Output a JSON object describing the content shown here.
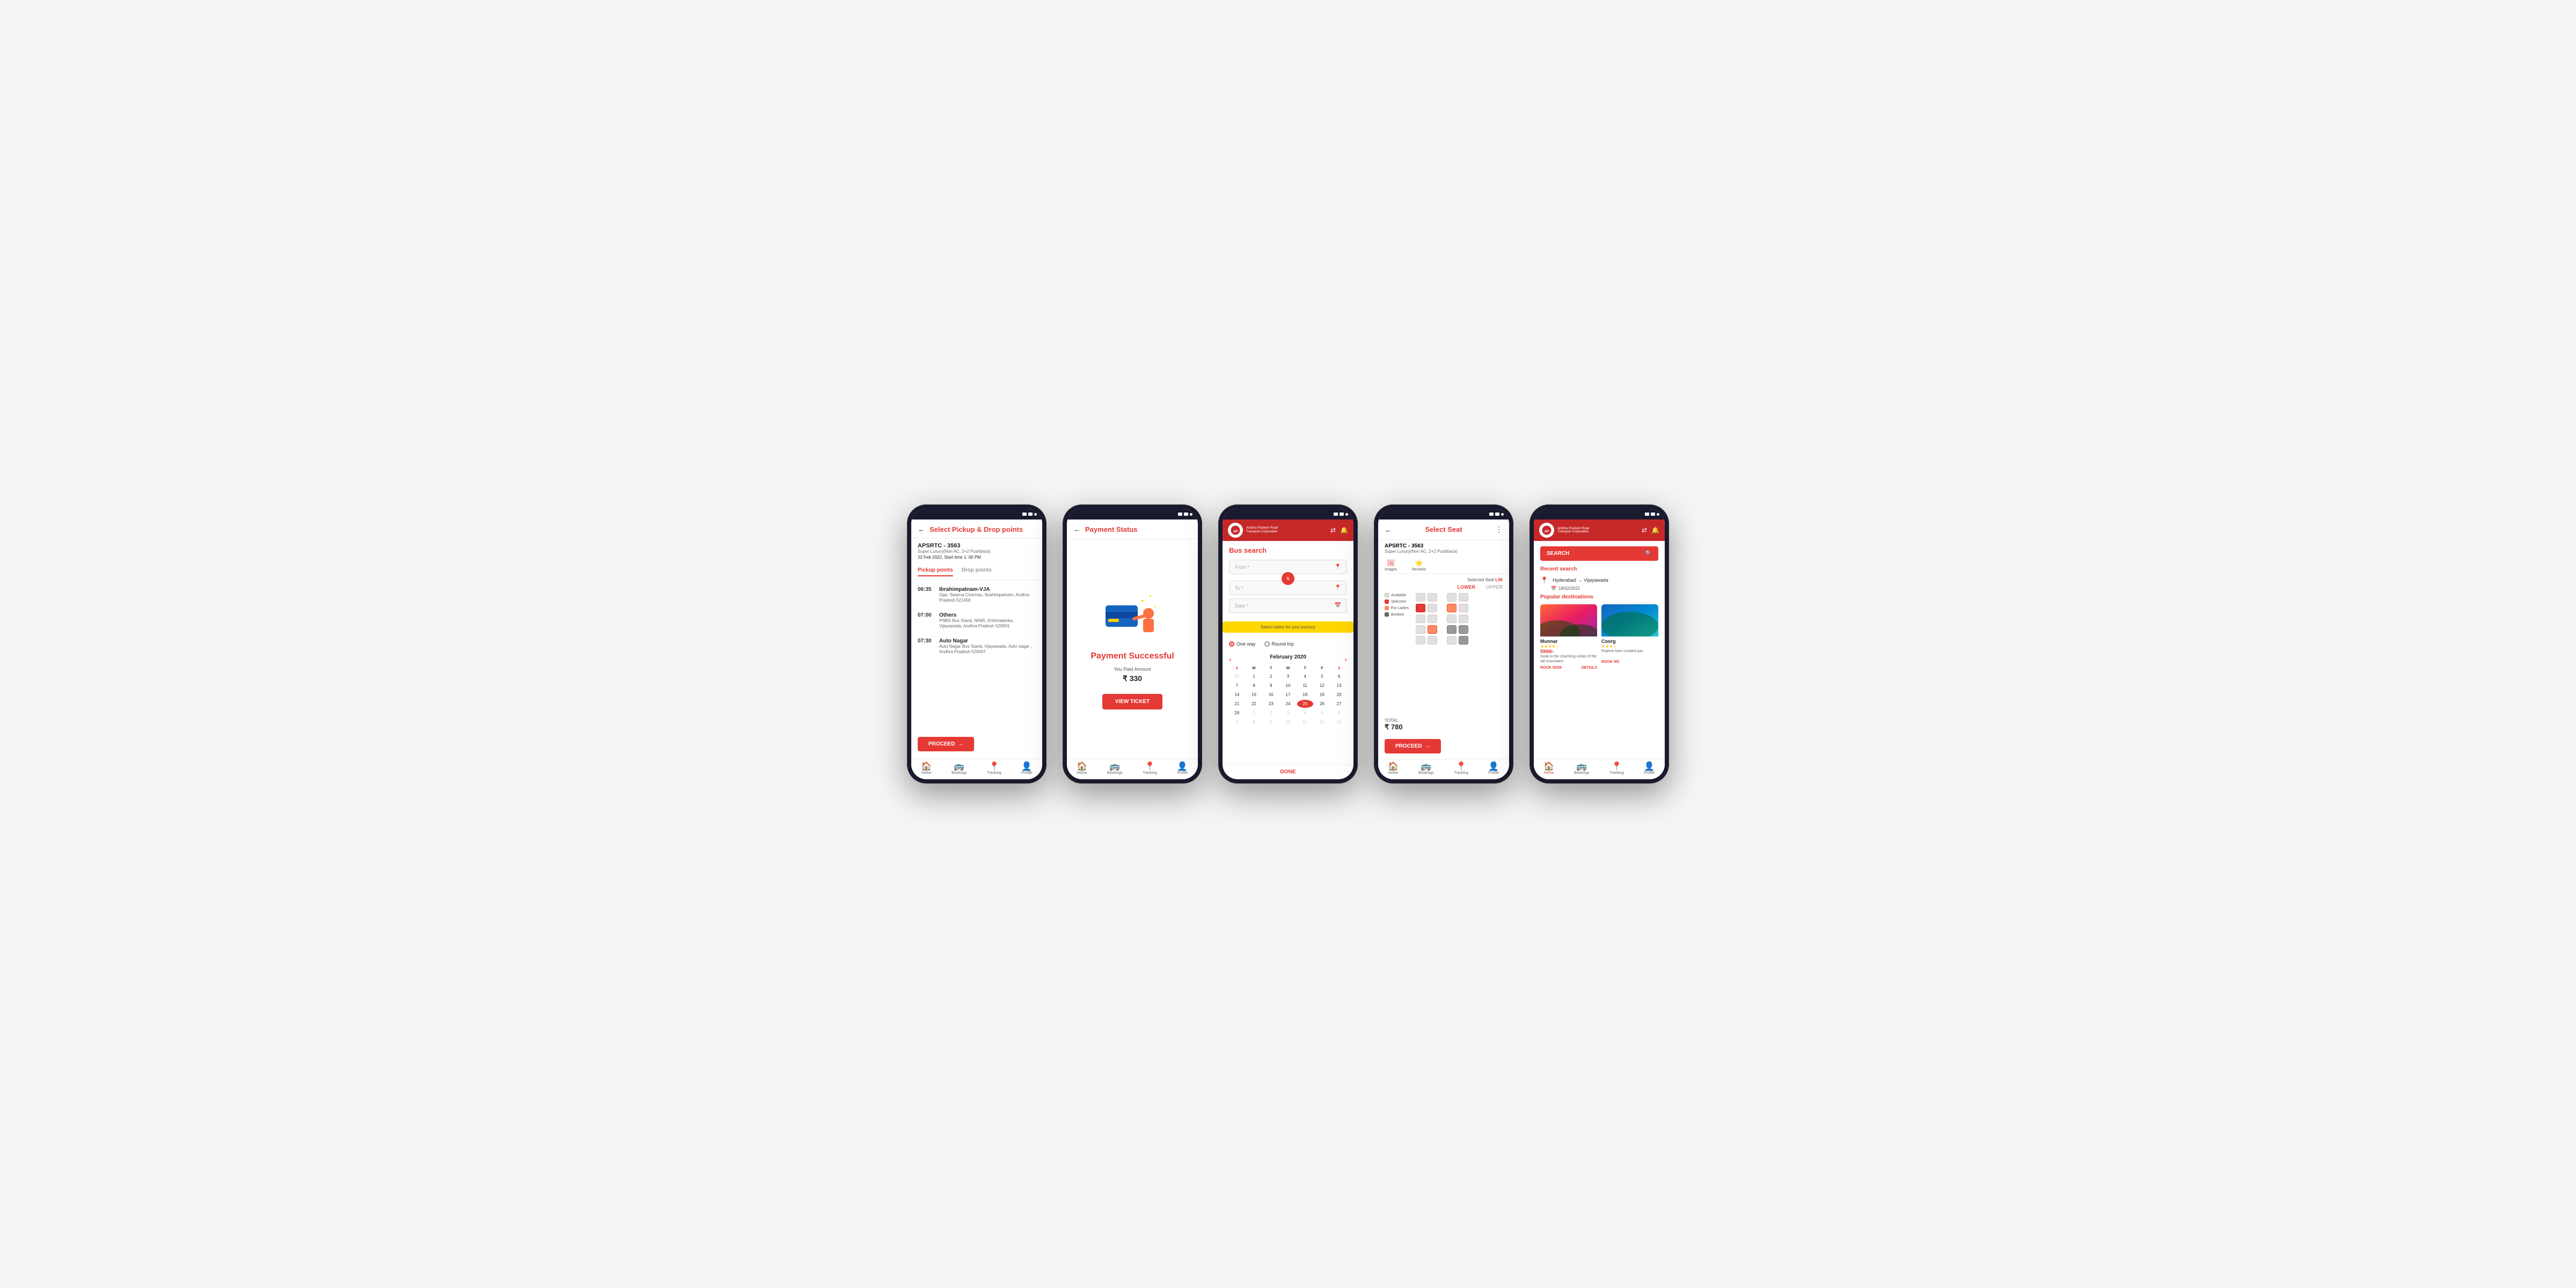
{
  "phone1": {
    "status_bar": "status",
    "header": {
      "back_label": "←",
      "title": "Select Pickup & Drop points"
    },
    "bus": {
      "name": "APSRTC - 3563",
      "type": "Super Luxury(Non AC, 2+2 Pushback)",
      "date": "22 Feb 2022, Start time 1: 00 PM"
    },
    "tabs": {
      "pickup": "Pickup points",
      "drop": "Drop points"
    },
    "stops": [
      {
        "time": "06:35",
        "name": "Ibrahimpatnam-VJA",
        "address": "Opp. Swarna Cinemax, Ibrahimpatnam, Andhra Pradesh 521456"
      },
      {
        "time": "07:00",
        "name": "Others",
        "address": "PNBS Bus Stand, NH65, Krishnalanka, Vijayawada, Andhra Pradesh 520001"
      },
      {
        "time": "07:30",
        "name": "Auto Nagar",
        "address": "Auto Nagar Bus Stand, Vijayawada, Auto nagar , Andhra Pradesh 520007"
      }
    ],
    "proceed_btn": "PROCEED",
    "nav": {
      "home": "Home",
      "bookings": "Bookings",
      "tracking": "Tracking",
      "profile": "Profile"
    }
  },
  "phone2": {
    "header": {
      "back_label": "←",
      "title": "Payment Status"
    },
    "success_title": "Payment Successful",
    "amount_label": "You Paid Amount",
    "amount": "₹ 330",
    "view_ticket_btn": "VIEW TICKET",
    "nav": {
      "home": "Home",
      "bookings": "Bookings",
      "tracking": "Tracking",
      "profile": "Profile"
    }
  },
  "phone3": {
    "logo_text": "Andhra Pradesh Road Transport Corporation",
    "search_title": "Bus search",
    "from_placeholder": "From *",
    "to_placeholder": "To *",
    "date_placeholder": "Date *",
    "date_banner": "Select dates for your journey",
    "trip_options": {
      "one_way": "One way",
      "round_trip": "Round trip"
    },
    "calendar": {
      "month_year": "February 2020",
      "day_headers": [
        "S",
        "M",
        "T",
        "W",
        "T",
        "F",
        "S"
      ],
      "weeks": [
        [
          "31",
          "1",
          "2",
          "3",
          "4",
          "5",
          "6"
        ],
        [
          "7",
          "8",
          "9",
          "10",
          "11",
          "12",
          "13"
        ],
        [
          "14",
          "15",
          "16",
          "17",
          "18",
          "19",
          "20"
        ],
        [
          "21",
          "22",
          "23",
          "24",
          "25",
          "26",
          "27"
        ],
        [
          "28",
          "1",
          "2",
          "3",
          "4",
          "5",
          "6"
        ],
        [
          "7",
          "8",
          "9",
          "10",
          "11",
          "12",
          "13"
        ]
      ],
      "today_index": "25",
      "today_week": 3,
      "today_day": 4
    },
    "done_btn": "DONE",
    "nav": {
      "home": "Home",
      "bookings": "Bookings",
      "tracking": "Tracking",
      "profile": "Profile"
    }
  },
  "phone4": {
    "header": {
      "back_label": "←",
      "title": "Select Seat",
      "more_icon": "⋮"
    },
    "bus": {
      "name": "APSRTC - 3563",
      "type": "Super Luxury(Non AC, 2+2 Pushback)"
    },
    "selected_label": "Selected Seat",
    "selected_seat": "L06",
    "deck_tabs": {
      "lower": "LOWER",
      "upper": "UPPER"
    },
    "legend": {
      "available": "Available",
      "selected": "Selected",
      "ladies": "For Ladies",
      "booked": "Booked"
    },
    "side_labels": {
      "images": "Images",
      "reviews": "Reviews"
    },
    "total_label": "TOTAL",
    "total_amount": "₹ 780",
    "proceed_btn": "PROCEED",
    "nav": {
      "home": "Home",
      "bookings": "Bookings",
      "tracking": "Tracking",
      "profile": "Profile"
    }
  },
  "phone5": {
    "logo_text": "Andhra Pradesh Road Transport Corporation",
    "search_btn": "SEARCH",
    "recent_section_title": "Recent search",
    "recent_route": "Hyderabad → Vijayawada",
    "recent_date": "18/02/2022",
    "popular_title": "Popular destinations",
    "destinations": [
      {
        "name": "Munnar",
        "stars": "★★★★☆",
        "price": "5999/-",
        "desc": "Soak in the charming vistas of the tall mountains",
        "book_btn": "BOOK NOW",
        "details_btn": "DETAILS"
      },
      {
        "name": "Coorg",
        "stars": "★★★☆",
        "desc": "Explore karn curated pac",
        "book_btn": "BOOK NO"
      }
    ],
    "nav": {
      "home": "Home",
      "bookings": "Bookings",
      "tracking": "Tracking",
      "profile": "Profile"
    }
  }
}
